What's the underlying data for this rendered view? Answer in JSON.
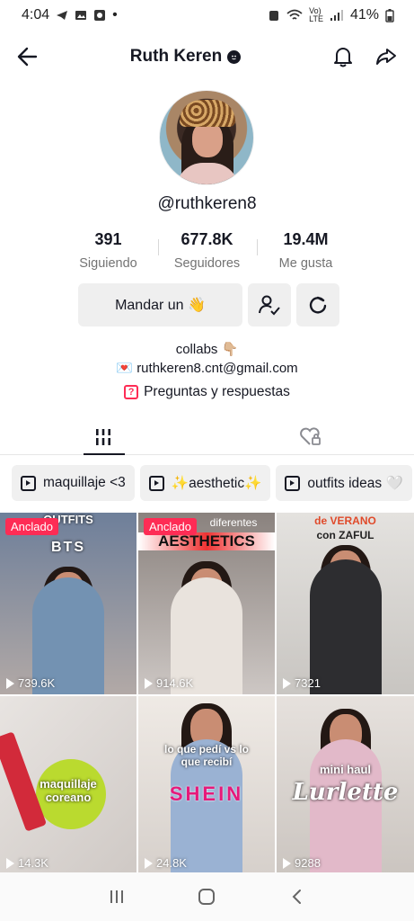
{
  "status_bar": {
    "time": "4:04",
    "battery": "41%"
  },
  "header": {
    "title": "Ruth Keren"
  },
  "profile": {
    "handle": "@ruthkeren8",
    "stats": [
      {
        "value": "391",
        "label": "Siguiendo"
      },
      {
        "value": "677.8K",
        "label": "Seguidores"
      },
      {
        "value": "19.4M",
        "label": "Me gusta"
      }
    ],
    "message_button": "Mandar un 👋",
    "bio_line1": "collabs 👇🏼",
    "bio_line2": "💌 ruthkeren8.cnt@gmail.com",
    "qa_label": "Preguntas y respuestas"
  },
  "playlists": [
    {
      "label": "maquillaje <3"
    },
    {
      "label": "✨aesthetic✨"
    },
    {
      "label": "outfits ideas 🤍"
    }
  ],
  "videos": [
    {
      "pinned": "Anclado",
      "views": "739.6K",
      "caption": "OUTFITS",
      "sub": "BTS",
      "bg": "#8b9bb0"
    },
    {
      "pinned": "Anclado",
      "views": "914.6K",
      "caption": "diferentes",
      "sub": "AESTHETICS",
      "bg": "#b9b4b2"
    },
    {
      "views": "7321",
      "caption": "de VERANO",
      "sub": "con ZAFUL",
      "bg": "#d9d8d6"
    },
    {
      "views": "14.3K",
      "caption": "maquillaje coreano",
      "sub": "",
      "bg": "#d8d4d2"
    },
    {
      "views": "24.8K",
      "caption": "lo que pedí vs lo que recibí",
      "sub": "SHEIN",
      "bg": "#e1dbd6"
    },
    {
      "views": "9288",
      "caption": "mini haul",
      "sub": "Lurlette",
      "bg": "#dcd6d2"
    }
  ],
  "icons": {
    "back": "arrow-left-icon",
    "bell": "bell-icon",
    "share": "share-icon",
    "grid": "grid-icon",
    "liked": "heart-lock-icon"
  }
}
